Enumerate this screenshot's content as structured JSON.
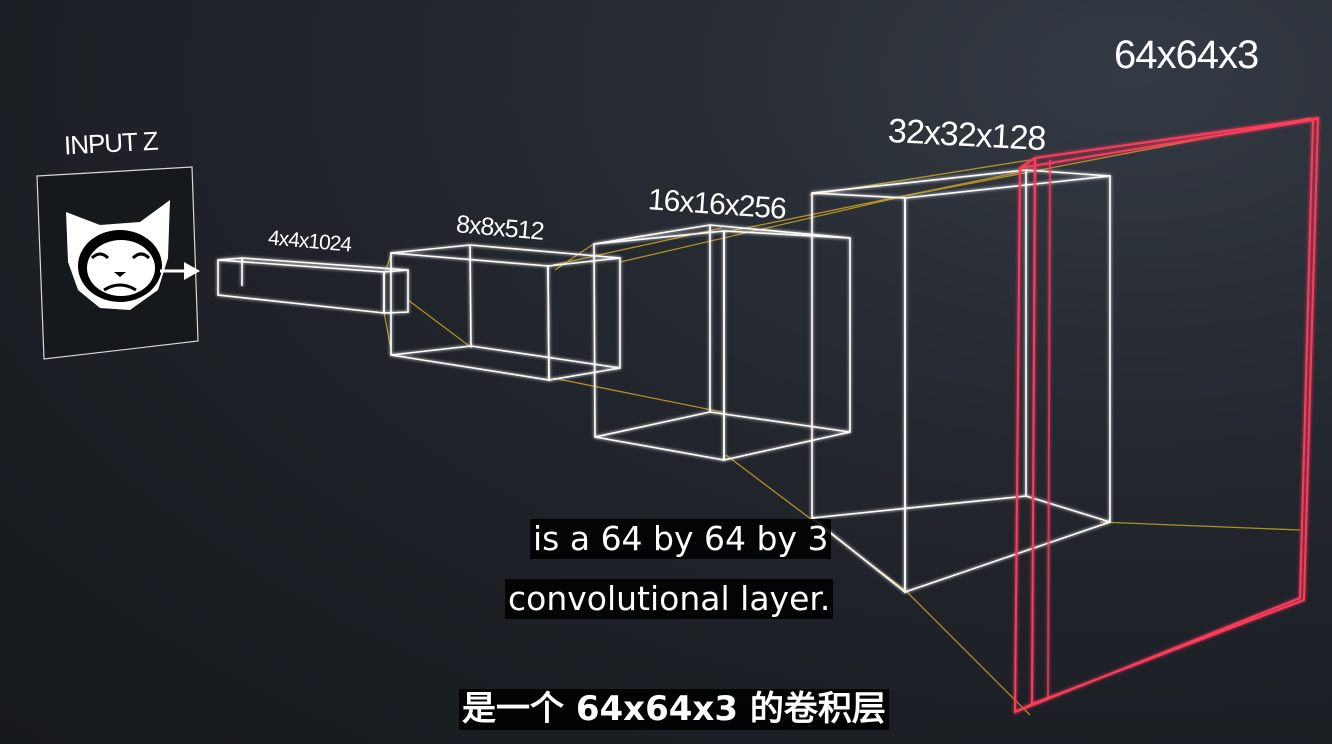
{
  "input": {
    "label": "INPUT Z",
    "icon": "grumpy-cat-face-icon"
  },
  "layers": [
    {
      "label": "4x4x1024"
    },
    {
      "label": "8x8x512"
    },
    {
      "label": "16x16x256"
    },
    {
      "label": "32x32x128"
    },
    {
      "label": "64x64x3"
    }
  ],
  "subtitles": {
    "en_line1": "is a 64 by 64 by 3",
    "en_line2": "convolutional layer.",
    "zh": "是一个 64x64x3 的卷积层"
  },
  "colors": {
    "block_stroke": "#ffffff",
    "output_stroke": "#ff3b5c",
    "connector": "#c9a227"
  }
}
